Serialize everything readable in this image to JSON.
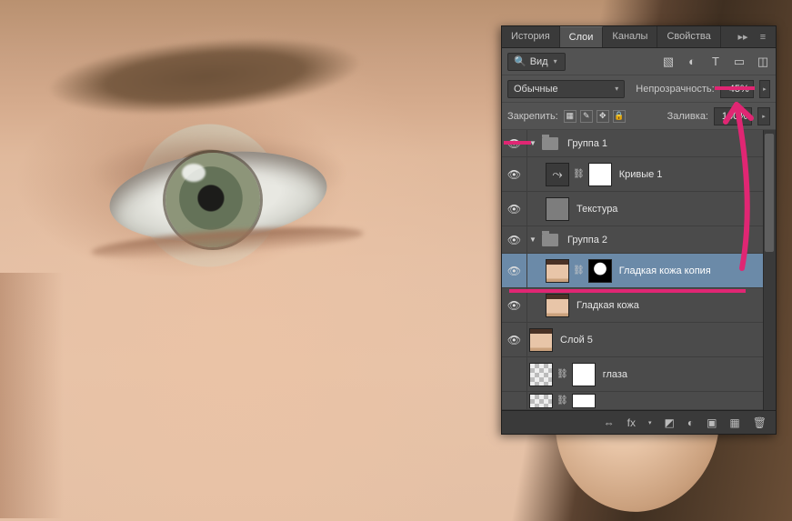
{
  "tabs": {
    "history": "История",
    "layers": "Слои",
    "channels": "Каналы",
    "properties": "Свойства"
  },
  "toolbar": {
    "search_label": "Вид",
    "blend_mode": "Обычные",
    "opacity_label": "Непрозрачность:",
    "opacity_value": "45%",
    "lock_label": "Закрепить:",
    "fill_label": "Заливка:",
    "fill_value": "100%"
  },
  "layers": [
    {
      "type": "group",
      "name": "Группа 1",
      "depth": 0,
      "open": true
    },
    {
      "type": "adjustment",
      "name": "Кривые 1",
      "depth": 1,
      "has_mask": true
    },
    {
      "type": "layer",
      "name": "Текстура",
      "depth": 1,
      "thumb": "grey"
    },
    {
      "type": "group",
      "name": "Группа 2",
      "depth": 0,
      "open": true
    },
    {
      "type": "layer",
      "name": "Гладкая кожа копия",
      "depth": 1,
      "thumb": "skin",
      "has_mask": true,
      "selected": true
    },
    {
      "type": "layer",
      "name": "Гладкая кожа",
      "depth": 1,
      "thumb": "skin"
    },
    {
      "type": "layer",
      "name": "Слой 5",
      "depth": 0,
      "thumb": "skin"
    },
    {
      "type": "layer",
      "name": "глаза",
      "depth": 0,
      "thumb": "checker",
      "has_mask": true,
      "mask": "white",
      "vis_off": true
    },
    {
      "type": "layer",
      "name": "",
      "depth": 0,
      "thumb": "checker",
      "has_mask": true,
      "mask": "white",
      "partial": true
    }
  ],
  "footer": {
    "link": "⇔",
    "fx": "fx",
    "mask": "◩",
    "adjust": "◐",
    "group": "▣",
    "new": "▦",
    "trash": "🗑"
  }
}
